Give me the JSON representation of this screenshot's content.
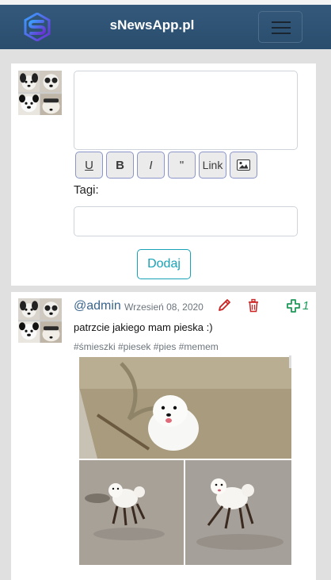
{
  "navbar": {
    "brand": "sNewsApp.pl",
    "logo_icon": "s-logo-icon",
    "menu_icon": "hamburger-menu-icon"
  },
  "compose": {
    "toolbar": {
      "underline_label": "U",
      "bold_label": "B",
      "italic_label": "I",
      "quote_label": "\"",
      "link_label": "Link",
      "image_icon": "image-icon"
    },
    "tags_label": "Tagi:",
    "submit_label": "Dodaj"
  },
  "post": {
    "author": "@admin",
    "date": "Wrzesień 08, 2020",
    "text": "patrzcie jakiego mam pieska :)",
    "tags": "#śmieszki #piesek #pies #memem",
    "votes": "1",
    "icons": [
      "pencil-icon",
      "trash-icon",
      "plus-icon"
    ]
  },
  "colors": {
    "navbar": "#2e5272",
    "page_bg": "#e0e0e0",
    "accent": "#17a2b8",
    "author": "#39648c",
    "delete": "#cc2222",
    "vote": "#1e9a5a"
  }
}
